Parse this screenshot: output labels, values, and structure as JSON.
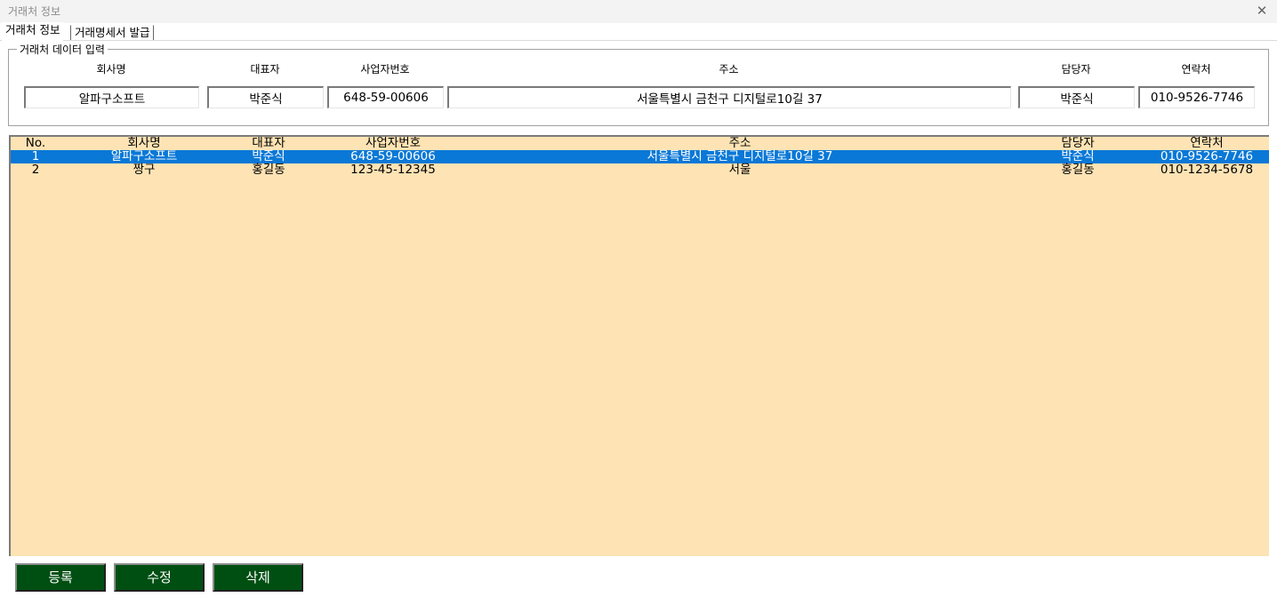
{
  "window": {
    "title": "거래처 정보",
    "close_glyph": "✕"
  },
  "tabs": [
    {
      "label": "거래처 정보",
      "active": true
    },
    {
      "label": "거래명세서 발급",
      "active": false
    }
  ],
  "form": {
    "legend": "거래처 데이터 입력",
    "labels": {
      "company": "회사명",
      "ceo": "대표자",
      "bizno": "사업자번호",
      "address": "주소",
      "manager": "담당자",
      "phone": "연락처"
    },
    "values": {
      "company": "알파구소프트",
      "ceo": "박준식",
      "bizno": "648-59-00606",
      "address": "서울특별시 금천구 디지털로10길 37",
      "manager": "박준식",
      "phone": "010-9526-7746"
    }
  },
  "list": {
    "columns": {
      "no": "No.",
      "company": "회사명",
      "ceo": "대표자",
      "bizno": "사업자번호",
      "address": "주소",
      "manager": "담당자",
      "phone": "연락처"
    },
    "rows": [
      {
        "no": "1",
        "company": "알파구소프트",
        "ceo": "박준식",
        "bizno": "648-59-00606",
        "address": "서울특별시 금천구 디지털로10길 37",
        "manager": "박준식",
        "phone": "010-9526-7746",
        "selected": true
      },
      {
        "no": "2",
        "company": "짱구",
        "ceo": "홍길동",
        "bizno": "123-45-12345",
        "address": "서울",
        "manager": "홍길동",
        "phone": "010-1234-5678",
        "selected": false
      }
    ],
    "selected_color": "#0a78d7",
    "background_color": "#fee3b4"
  },
  "buttons": {
    "register": "등록",
    "edit": "수정",
    "delete": "삭제",
    "color": "#004f12"
  }
}
